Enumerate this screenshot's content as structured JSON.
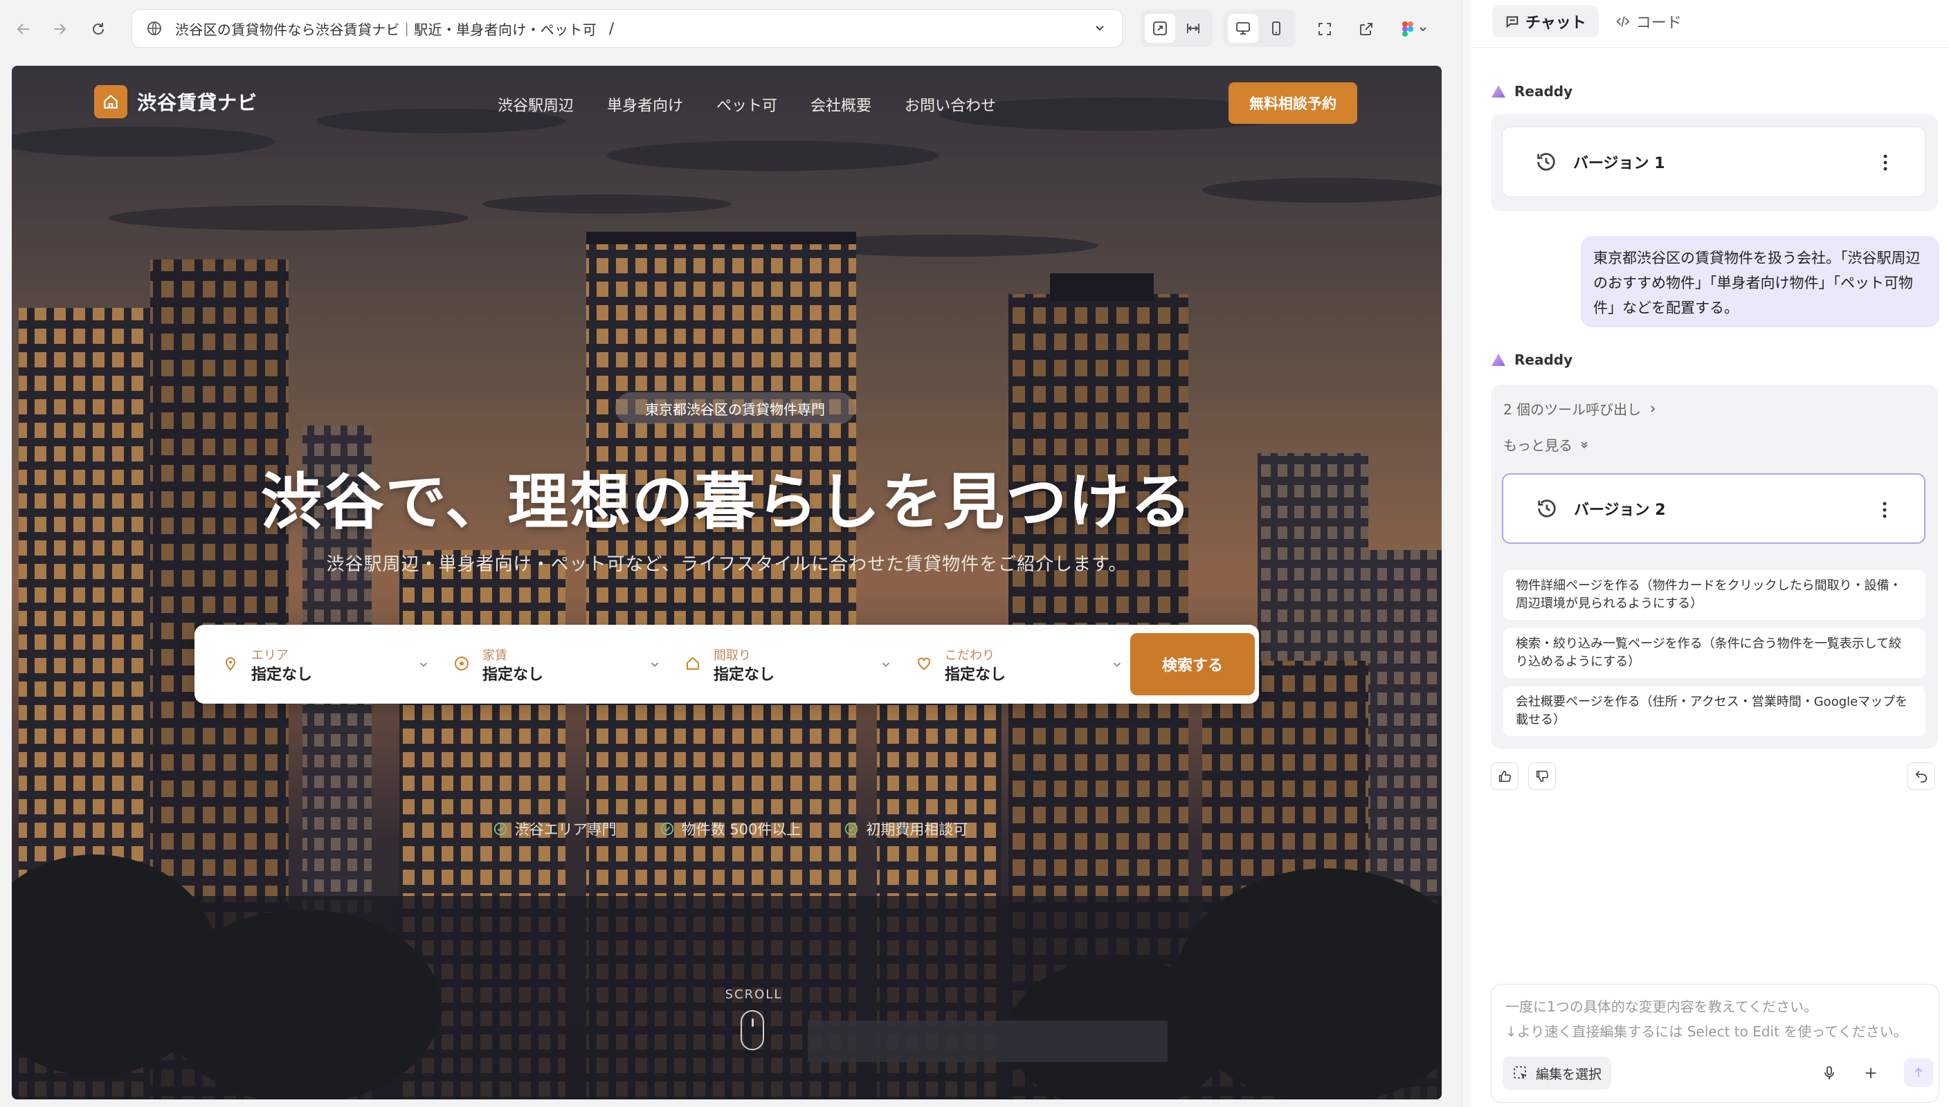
{
  "browser": {
    "url_title": "渋谷区の賃貸物件なら渋谷賃貸ナビ｜駅近・単身者向け・ペット可",
    "url_path": "/"
  },
  "site": {
    "logo_text": "渋谷賃貸ナビ",
    "nav": [
      "渋谷駅周辺",
      "単身者向け",
      "ペット可",
      "会社概要",
      "お問い合わせ"
    ],
    "cta": "無料相談予約",
    "badge": "東京都渋谷区の賃貸物件専門",
    "title": "渋谷で、理想の暮らしを見つける",
    "subtitle": "渋谷駅周辺・単身者向け・ペット可など、ライフスタイルに合わせた賃貸物件をご紹介します。",
    "search": {
      "fields": [
        {
          "label": "エリア",
          "value": "指定なし"
        },
        {
          "label": "家賃",
          "value": "指定なし"
        },
        {
          "label": "間取り",
          "value": "指定なし"
        },
        {
          "label": "こだわり",
          "value": "指定なし"
        }
      ],
      "button": "検索する"
    },
    "features": [
      "渋谷エリア専門",
      "物件数 500件以上",
      "初期費用相談可"
    ],
    "scroll": "SCROLL",
    "accent": "#d4822e"
  },
  "chat": {
    "tabs": {
      "chat": "チャット",
      "code": "コード"
    },
    "author": "Readdy",
    "version1": "バージョン 1",
    "user_message": "東京都渋谷区の賃貸物件を扱う会社。「渋谷駅周辺のおすすめ物件」「単身者向け物件」「ペット可物件」などを配置する。",
    "tool_calls": "2 個のツール呼び出し",
    "show_more": "もっと見る",
    "version2": "バージョン 2",
    "suggestions": [
      "物件詳細ページを作る（物件カードをクリックしたら間取り・設備・周辺環境が見られるようにする）",
      "検索・絞り込み一覧ページを作る（条件に合う物件を一覧表示して絞り込めるようにする）",
      "会社概要ページを作る（住所・アクセス・営業時間・Googleマップを載せる）"
    ],
    "composer": {
      "placeholder_1": "一度に1つの具体的な変更内容を教えてください。",
      "placeholder_2": "↓より速く直接編集するには Select to Edit を使ってください。",
      "select_edit": "編集を選択"
    }
  }
}
